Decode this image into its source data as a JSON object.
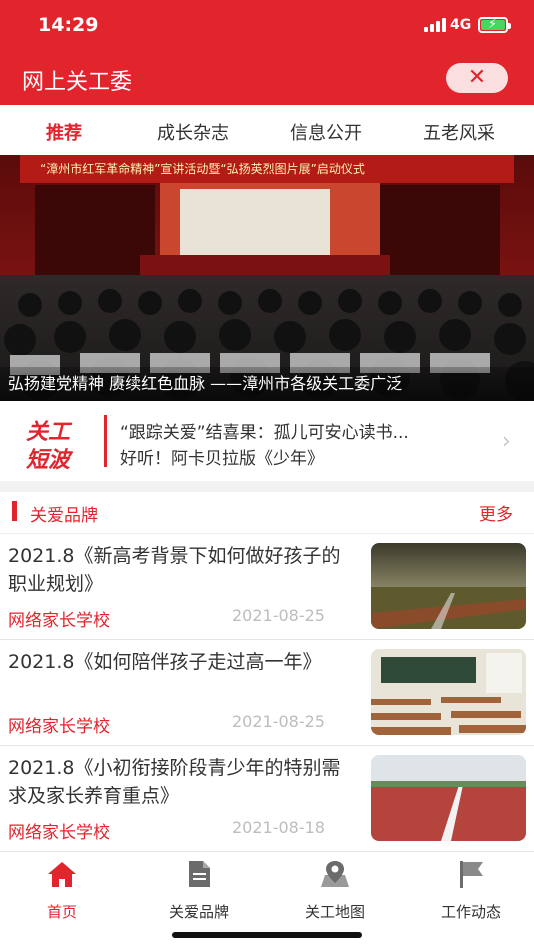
{
  "status": {
    "time": "14:29",
    "network": "4G"
  },
  "header": {
    "title": "网上关工委",
    "close_icon": "close-icon"
  },
  "tabs": [
    {
      "label": "推荐",
      "active": true
    },
    {
      "label": "成长杂志",
      "active": false
    },
    {
      "label": "信息公开",
      "active": false
    },
    {
      "label": "五老风采",
      "active": false
    }
  ],
  "banner": {
    "stage_banner_text": "“漳州市红军革命精神”宣讲活动暨“弘扬英烈图片展”启动仪式",
    "caption": "弘扬建党精神 赓续红色血脉 ——漳州市各级关工委广泛"
  },
  "ticker": {
    "badge_line1": "关工",
    "badge_line2": "短波",
    "line1": "“跟踪关爱”结喜果：孤儿可安心读书...",
    "line2": "好听！阿卡贝拉版《少年》"
  },
  "section": {
    "title": "关爱品牌",
    "more": "更多"
  },
  "articles": [
    {
      "title": "2021.8《新高考背景下如何做好孩子的职业规划》",
      "source": "网络家长学校",
      "date": "2021-08-25"
    },
    {
      "title": "2021.8《如何陪伴孩子走过高一年》",
      "source": "网络家长学校",
      "date": "2021-08-25"
    },
    {
      "title": "2021.8《小初衔接阶段青少年的特别需求及家长养育重点》",
      "source": "网络家长学校",
      "date": "2021-08-18"
    }
  ],
  "bottom_nav": [
    {
      "label": "首页",
      "icon": "home-icon",
      "active": true
    },
    {
      "label": "关爱品牌",
      "icon": "document-icon",
      "active": false
    },
    {
      "label": "关工地图",
      "icon": "map-icon",
      "active": false
    },
    {
      "label": "工作动态",
      "icon": "flag-icon",
      "active": false
    }
  ],
  "colors": {
    "brand": "#e2242d",
    "text": "#333333",
    "muted": "#bdbdbd"
  }
}
